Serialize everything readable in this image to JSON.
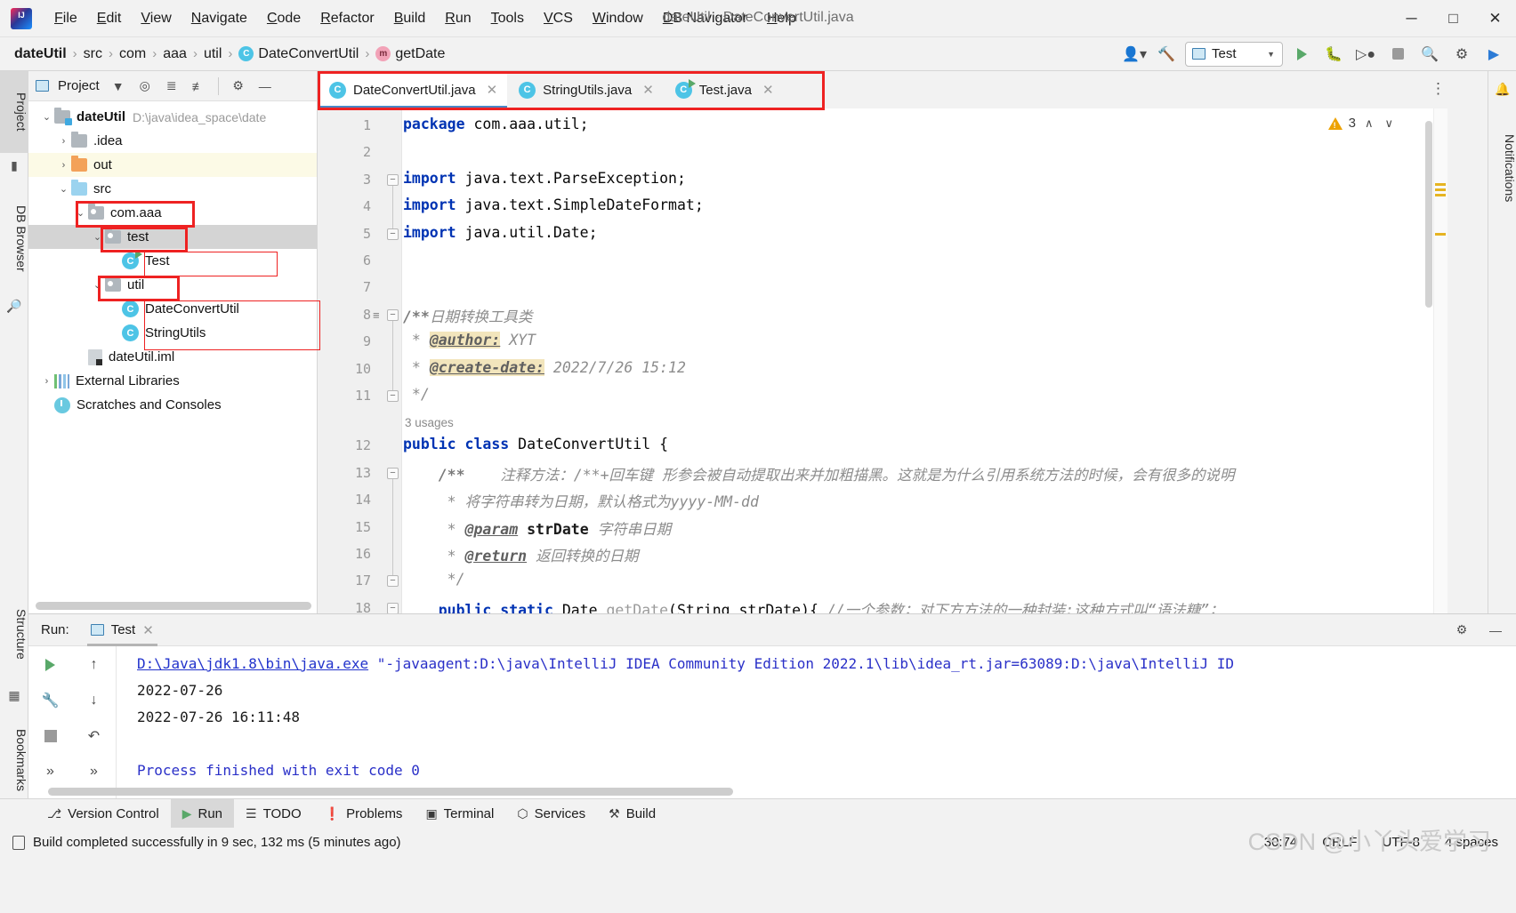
{
  "window": {
    "title": "dateUtil - DateConvertUtil.java",
    "minimize": "─",
    "maximize": "□",
    "close": "✕"
  },
  "menubar": {
    "items": [
      "File",
      "Edit",
      "View",
      "Navigate",
      "Code",
      "Refactor",
      "Build",
      "Run",
      "Tools",
      "VCS",
      "Window",
      "DB Navigator",
      "Help"
    ]
  },
  "breadcrumb": {
    "items": [
      {
        "label": "dateUtil",
        "icon": "none",
        "bold": true
      },
      {
        "label": "src",
        "icon": "none",
        "bold": false
      },
      {
        "label": "com",
        "icon": "none",
        "bold": false
      },
      {
        "label": "aaa",
        "icon": "none",
        "bold": false
      },
      {
        "label": "util",
        "icon": "none",
        "bold": false
      },
      {
        "label": "DateConvertUtil",
        "icon": "class-badge",
        "bold": false
      },
      {
        "label": "getDate",
        "icon": "method-badge",
        "bold": false
      }
    ],
    "class_badge_letter": "C",
    "method_badge_letter": "m",
    "separator": "›"
  },
  "navbar_right": {
    "run_config": "Test",
    "icons": [
      "account-icon",
      "hammer-build-icon",
      "run-icon",
      "debug-icon",
      "run-coverage-icon",
      "stop-icon",
      "search-icon",
      "settings-gear-icon",
      "ide-assistant-icon"
    ]
  },
  "left_tool_strip": {
    "tabs": [
      "Project",
      "DB Browser",
      "Structure",
      "Bookmarks"
    ]
  },
  "right_tool_strip": {
    "tabs": [
      "Notifications"
    ]
  },
  "project_panel": {
    "title": "Project",
    "toolbar_icons": [
      "chevron-down-icon",
      "locate-target-icon",
      "expand-all-icon",
      "collapse-all-icon",
      "gear-icon",
      "hide-icon"
    ],
    "tree": [
      {
        "indent": 0,
        "arrow": "⌄",
        "icon": "module",
        "label": "dateUtil",
        "bold": true,
        "path": "D:\\java\\idea_space\\date",
        "state": "normal"
      },
      {
        "indent": 1,
        "arrow": "›",
        "icon": "folder-gray",
        "label": ".idea",
        "bold": false,
        "path": "",
        "state": "normal"
      },
      {
        "indent": 1,
        "arrow": "›",
        "icon": "folder-orange",
        "label": "out",
        "bold": false,
        "path": "",
        "state": "highlight"
      },
      {
        "indent": 1,
        "arrow": "⌄",
        "icon": "folder-blue",
        "label": "src",
        "bold": false,
        "path": "",
        "state": "normal"
      },
      {
        "indent": 2,
        "arrow": "⌄",
        "icon": "package",
        "label": "com.aaa",
        "bold": false,
        "path": "",
        "state": "normal"
      },
      {
        "indent": 3,
        "arrow": "⌄",
        "icon": "package",
        "label": "test",
        "bold": false,
        "path": "",
        "state": "selected"
      },
      {
        "indent": 4,
        "arrow": "",
        "icon": "class-runnable",
        "label": "Test",
        "bold": false,
        "path": "",
        "state": "normal"
      },
      {
        "indent": 3,
        "arrow": "⌄",
        "icon": "package",
        "label": "util",
        "bold": false,
        "path": "",
        "state": "normal"
      },
      {
        "indent": 4,
        "arrow": "",
        "icon": "class",
        "label": "DateConvertUtil",
        "bold": false,
        "path": "",
        "state": "normal"
      },
      {
        "indent": 4,
        "arrow": "",
        "icon": "class",
        "label": "StringUtils",
        "bold": false,
        "path": "",
        "state": "normal"
      },
      {
        "indent": 2,
        "arrow": "",
        "icon": "iml",
        "label": "dateUtil.iml",
        "bold": false,
        "path": "",
        "state": "normal"
      },
      {
        "indent": 0,
        "arrow": "›",
        "icon": "library",
        "label": "External Libraries",
        "bold": false,
        "path": "",
        "state": "normal"
      },
      {
        "indent": 0,
        "arrow": "",
        "icon": "scratch",
        "label": "Scratches and Consoles",
        "bold": false,
        "path": "",
        "state": "normal"
      }
    ]
  },
  "editor_tabs": {
    "tabs": [
      {
        "label": "DateConvertUtil.java",
        "icon": "class-badge",
        "active": true,
        "close": "✕"
      },
      {
        "label": "StringUtils.java",
        "icon": "class-badge",
        "active": false,
        "close": "✕"
      },
      {
        "label": "Test.java",
        "icon": "class-runnable-badge",
        "active": false,
        "close": "✕"
      }
    ],
    "overflow_menu": "⋮"
  },
  "editor": {
    "inspection_count": "3",
    "up_chevron": "∧",
    "down_chevron": "∨",
    "usages_hint": "3 usages",
    "lines": [
      {
        "num": "1",
        "html": "<span class=\"kw\">package</span> com.aaa.util;"
      },
      {
        "num": "2",
        "html": ""
      },
      {
        "num": "3",
        "html": "<span class=\"kw\">import</span> java.text.ParseException;"
      },
      {
        "num": "4",
        "html": "<span class=\"kw\">import</span> java.text.SimpleDateFormat;"
      },
      {
        "num": "5",
        "html": "<span class=\"kw\">import</span> java.util.Date;"
      },
      {
        "num": "6",
        "html": ""
      },
      {
        "num": "7",
        "html": ""
      },
      {
        "num": "8",
        "html": "<span class=\"cmbold\">/**</span><span class=\"cm\">日期转换工具类</span>"
      },
      {
        "num": "9",
        "html": "<span class=\"cm\"> * </span><span class=\"tag\">@author:</span><span class=\"cm\"> XYT</span>"
      },
      {
        "num": "10",
        "html": "<span class=\"cm\"> * </span><span class=\"tag\">@create-date:</span><span class=\"cm\"> 2022/7/26 15:12</span>"
      },
      {
        "num": "11",
        "html": "<span class=\"cm\"> */</span>"
      },
      {
        "num": "12",
        "html": "<span class=\"kw\">public class</span> DateConvertUtil {"
      },
      {
        "num": "13",
        "html": "    <span class=\"cmbold\">/**</span><span class=\"cm\">    注释方法：/**+回车键 形参会被自动提取出来并加粗描黑。这就是为什么引用系统方法的时候，会有很多的说明</span>"
      },
      {
        "num": "14",
        "html": "<span class=\"cm\">     * 将字符串转为日期，默认格式为yyyy-MM-dd</span>"
      },
      {
        "num": "15",
        "html": "<span class=\"cm\">     * </span><span class=\"tagnb\">@param</span><span class=\"cm\"> </span><span class=\"param\">strDate</span><span class=\"cm\"> 字符串日期</span>"
      },
      {
        "num": "16",
        "html": "<span class=\"cm\">     * </span><span class=\"tagnb\">@return</span><span class=\"cm\"> 返回转换的日期</span>"
      },
      {
        "num": "17",
        "html": "<span class=\"cm\">     */</span>"
      },
      {
        "num": "18",
        "html": "    <span class=\"kw\">public static</span> Date <span class=\"mname\">getDate</span>(String strDate){ <span class=\"cm\">//一个参数；对下方方法的一种封装;这种方式叫“语法糖”；</span>"
      }
    ]
  },
  "run_panel": {
    "label": "Run:",
    "tab": "Test",
    "tab_close": "✕",
    "toolbar_icons": [
      "rerun-icon",
      "wrench-settings-icon",
      "stop-icon",
      "scroll-up-icon",
      "scroll-down-icon",
      "soft-wrap-icon",
      "minimize-icon",
      "expand-icons"
    ],
    "header_right_icons": [
      "gear-icon",
      "hide-icon"
    ],
    "console": [
      {
        "type": "link",
        "text": "D:\\Java\\jdk1.8\\bin\\java.exe",
        "rest": " \"-javaagent:D:\\java\\IntelliJ IDEA Community Edition 2022.1\\lib\\idea_rt.jar=63089:D:\\java\\IntelliJ ID"
      },
      {
        "type": "plain",
        "text": "2022-07-26",
        "rest": ""
      },
      {
        "type": "plain",
        "text": "2022-07-26 16:11:48",
        "rest": ""
      },
      {
        "type": "blank",
        "text": "",
        "rest": ""
      },
      {
        "type": "blue",
        "text": "Process finished with exit code 0",
        "rest": ""
      }
    ]
  },
  "bottom_bar": {
    "tabs": [
      {
        "label": "Version Control",
        "icon": "branch-icon",
        "selected": false
      },
      {
        "label": "Run",
        "icon": "run-icon",
        "selected": true
      },
      {
        "label": "TODO",
        "icon": "list-icon",
        "selected": false
      },
      {
        "label": "Problems",
        "icon": "error-icon",
        "selected": false
      },
      {
        "label": "Terminal",
        "icon": "terminal-icon",
        "selected": false
      },
      {
        "label": "Services",
        "icon": "services-icon",
        "selected": false
      },
      {
        "label": "Build",
        "icon": "hammer-icon",
        "selected": false
      }
    ]
  },
  "status_bar": {
    "message": "Build completed successfully in 9 sec, 132 ms (5 minutes ago)",
    "caret_position": "30:74",
    "line_separator": "CRLF",
    "encoding": "UTF-8",
    "indent": "4 spaces",
    "watermark": "CSDN @小丫头爱学习"
  },
  "colors": {
    "accent_blue": "#4a88c7",
    "keyword_blue": "#0033b3",
    "comment_gray": "#8c8c8c",
    "annotation_red": "#ee2222",
    "class_icon": "#4dc4e6",
    "run_green": "#59a869",
    "highlight_yellow": "#f2e5bc"
  }
}
